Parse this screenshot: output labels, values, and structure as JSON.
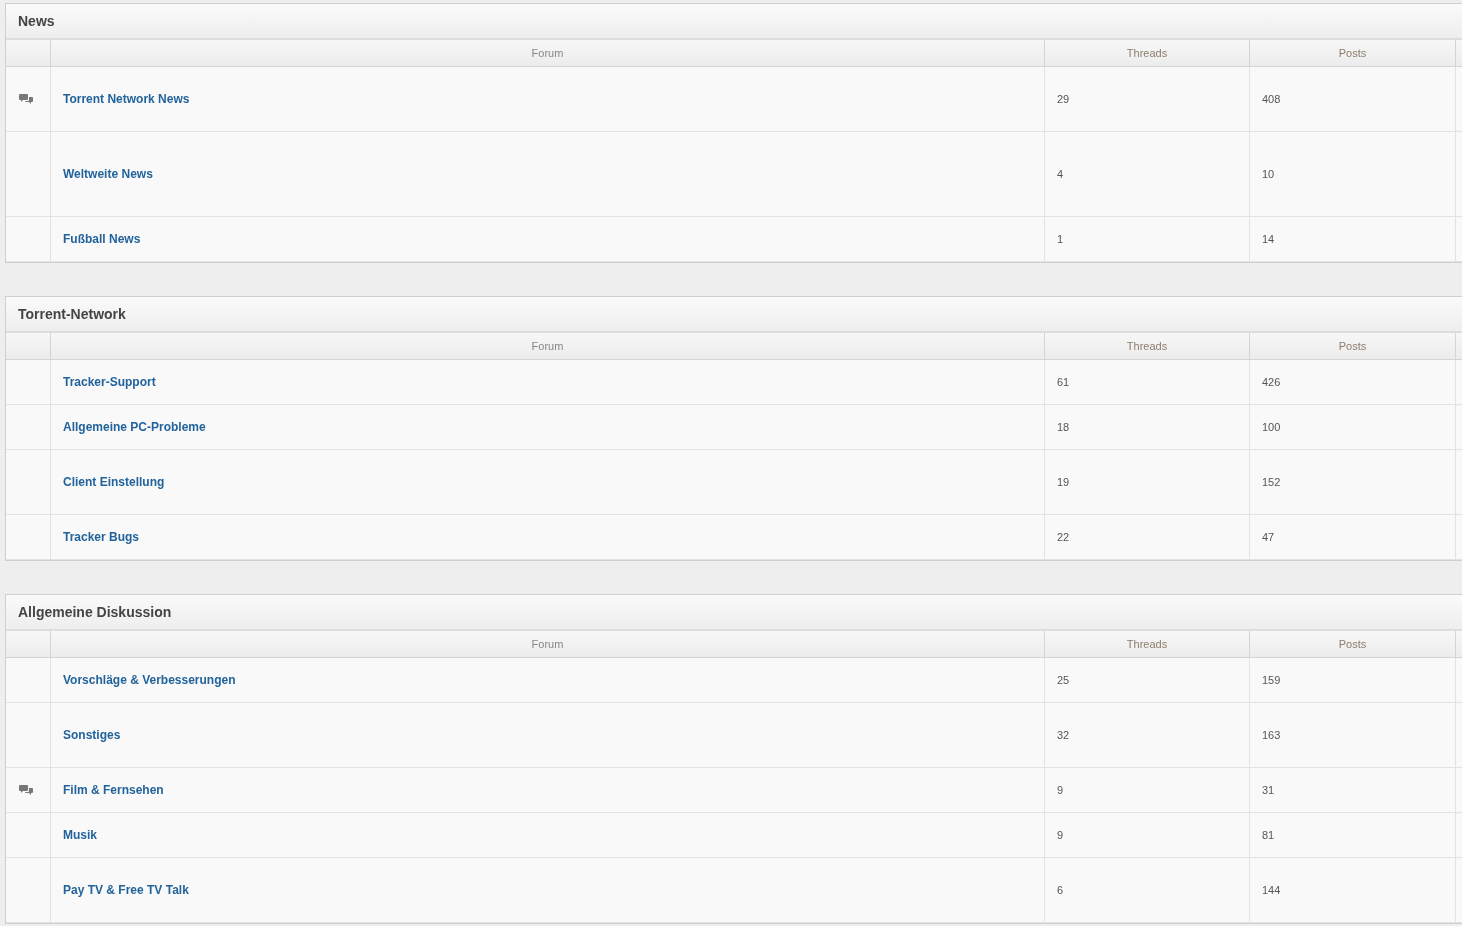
{
  "sections": [
    {
      "title": "News",
      "columns": [
        "Forum",
        "Threads",
        "Posts"
      ],
      "rows": [
        {
          "forum": "Torrent Network News",
          "threads": "29",
          "posts": "408",
          "unread": true
        },
        {
          "forum": "Weltweite News",
          "threads": "4",
          "posts": "10",
          "unread": false
        },
        {
          "forum": "Fußball News",
          "threads": "1",
          "posts": "14",
          "unread": false
        }
      ]
    },
    {
      "title": "Torrent-Network",
      "columns": [
        "Forum",
        "Threads",
        "Posts"
      ],
      "rows": [
        {
          "forum": "Tracker-Support",
          "threads": "61",
          "posts": "426",
          "unread": false
        },
        {
          "forum": "Allgemeine PC-Probleme",
          "threads": "18",
          "posts": "100",
          "unread": false
        },
        {
          "forum": "Client Einstellung",
          "threads": "19",
          "posts": "152",
          "unread": false
        },
        {
          "forum": "Tracker Bugs",
          "threads": "22",
          "posts": "47",
          "unread": false
        }
      ]
    },
    {
      "title": "Allgemeine Diskussion",
      "columns": [
        "Forum",
        "Threads",
        "Posts"
      ],
      "rows": [
        {
          "forum": "Vorschläge & Verbesserungen",
          "threads": "25",
          "posts": "159",
          "unread": false
        },
        {
          "forum": "Sonstiges",
          "threads": "32",
          "posts": "163",
          "unread": false
        },
        {
          "forum": "Film & Fernsehen",
          "threads": "9",
          "posts": "31",
          "unread": true
        },
        {
          "forum": "Musik",
          "threads": "9",
          "posts": "81",
          "unread": false
        },
        {
          "forum": "Pay TV & Free TV Talk",
          "threads": "6",
          "posts": "144",
          "unread": false
        }
      ]
    }
  ]
}
